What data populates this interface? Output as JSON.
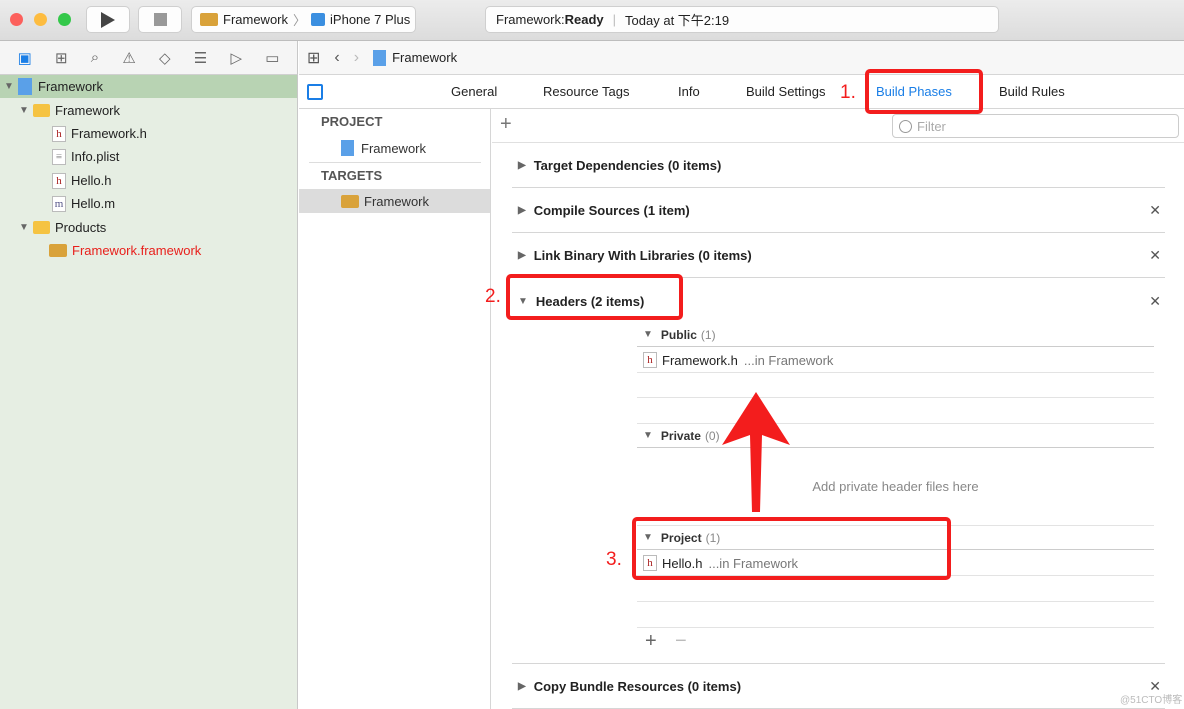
{
  "toolbar": {
    "scheme": "Framework",
    "device": "iPhone 7 Plus",
    "status_project": "Framework: ",
    "status_state": "Ready",
    "status_time": "Today at 下午2:19"
  },
  "navigator_icons": [
    "folder-icon",
    "hierarchy-icon",
    "search-icon",
    "warning-icon",
    "test-icon",
    "debug-icon",
    "breakpoint-icon",
    "report-icon"
  ],
  "sidebar": {
    "items": [
      {
        "label": "Framework",
        "type": "project",
        "level": 0,
        "expanded": true,
        "selected": true
      },
      {
        "label": "Framework",
        "type": "folder",
        "level": 1,
        "expanded": true
      },
      {
        "label": "Framework.h",
        "type": "h",
        "level": 2
      },
      {
        "label": "Info.plist",
        "type": "plist",
        "level": 2
      },
      {
        "label": "Hello.h",
        "type": "h",
        "level": 2
      },
      {
        "label": "Hello.m",
        "type": "m",
        "level": 2
      },
      {
        "label": "Products",
        "type": "folder",
        "level": 1,
        "expanded": true
      },
      {
        "label": "Framework.framework",
        "type": "framework",
        "level": 2,
        "missing": true
      }
    ]
  },
  "jumpbar": {
    "title": "Framework"
  },
  "tabs": [
    {
      "label": "General"
    },
    {
      "label": "Resource Tags"
    },
    {
      "label": "Info"
    },
    {
      "label": "Build Settings"
    },
    {
      "label": "Build Phases",
      "active": true
    },
    {
      "label": "Build Rules"
    }
  ],
  "targets": {
    "project_header": "PROJECT",
    "project": "Framework",
    "targets_header": "TARGETS",
    "target": "Framework"
  },
  "filter": {
    "placeholder": "Filter"
  },
  "phases": [
    {
      "label": "Target Dependencies (0 items)",
      "removable": false
    },
    {
      "label": "Compile Sources (1 item)",
      "removable": true
    },
    {
      "label": "Link Binary With Libraries (0 items)",
      "removable": true
    },
    {
      "label": "Headers (2 items)",
      "removable": true,
      "expanded": true
    },
    {
      "label": "Copy Bundle Resources (0 items)",
      "removable": true
    }
  ],
  "headers": {
    "public": {
      "label": "Public",
      "count": "(1)",
      "files": [
        {
          "name": "Framework.h",
          "location": "...in Framework"
        }
      ]
    },
    "private": {
      "label": "Private",
      "count": "(0)",
      "placeholder": "Add private header files here"
    },
    "project": {
      "label": "Project",
      "count": "(1)",
      "files": [
        {
          "name": "Hello.h",
          "location": "...in Framework"
        }
      ]
    }
  },
  "annotations": {
    "step1": "1.",
    "step2": "2.",
    "step3": "3.",
    "color": "#f31d1d"
  },
  "watermark": "@51CTO博客",
  "colors": {
    "accent": "#1a7ee6",
    "sidebar": "#e6eee3",
    "selected": "#b8d3b3",
    "missing": "#e8201c"
  }
}
